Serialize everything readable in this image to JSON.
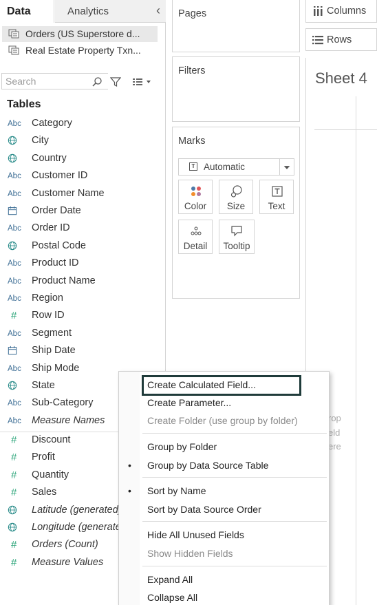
{
  "tabs": {
    "data": "Data",
    "analytics": "Analytics"
  },
  "datasources": [
    {
      "label": "Orders (US Superstore d...",
      "selected": true
    },
    {
      "label": "Real Estate Property Txn...",
      "selected": false
    }
  ],
  "search": {
    "placeholder": "Search"
  },
  "tables_heading": "Tables",
  "fields": [
    {
      "type": "abc",
      "label": "Category",
      "italic": false
    },
    {
      "type": "globe",
      "label": "City",
      "italic": false
    },
    {
      "type": "globe",
      "label": "Country",
      "italic": false
    },
    {
      "type": "abc",
      "label": "Customer ID",
      "italic": false
    },
    {
      "type": "abc",
      "label": "Customer Name",
      "italic": false
    },
    {
      "type": "calendar",
      "label": "Order Date",
      "italic": false
    },
    {
      "type": "abc",
      "label": "Order ID",
      "italic": false
    },
    {
      "type": "globe",
      "label": "Postal Code",
      "italic": false
    },
    {
      "type": "abc",
      "label": "Product ID",
      "italic": false
    },
    {
      "type": "abc",
      "label": "Product Name",
      "italic": false
    },
    {
      "type": "abc",
      "label": "Region",
      "italic": false
    },
    {
      "type": "hash",
      "label": "Row ID",
      "italic": false
    },
    {
      "type": "abc",
      "label": "Segment",
      "italic": false
    },
    {
      "type": "calendar",
      "label": "Ship Date",
      "italic": false
    },
    {
      "type": "abc",
      "label": "Ship Mode",
      "italic": false
    },
    {
      "type": "globe",
      "label": "State",
      "italic": false
    },
    {
      "type": "abc",
      "label": "Sub-Category",
      "italic": false
    },
    {
      "type": "abc",
      "label": "Measure Names",
      "italic": true
    }
  ],
  "measures": [
    {
      "type": "hash",
      "label": "Discount",
      "italic": false
    },
    {
      "type": "hash",
      "label": "Profit",
      "italic": false
    },
    {
      "type": "hash",
      "label": "Quantity",
      "italic": false
    },
    {
      "type": "hash",
      "label": "Sales",
      "italic": false
    },
    {
      "type": "globe",
      "label": "Latitude (generated)",
      "italic": true
    },
    {
      "type": "globe",
      "label": "Longitude (generated)",
      "italic": true
    },
    {
      "type": "hash",
      "label": "Orders (Count)",
      "italic": true
    },
    {
      "type": "hash",
      "label": "Measure Values",
      "italic": true
    }
  ],
  "shelves": {
    "pages": "Pages",
    "filters": "Filters",
    "marks": "Marks",
    "mark_type": "Automatic",
    "columns": "Columns",
    "rows": "Rows"
  },
  "mark_buttons": {
    "color": "Color",
    "size": "Size",
    "text": "Text",
    "detail": "Detail",
    "tooltip": "Tooltip"
  },
  "sheet": {
    "title": "Sheet 4",
    "drop_hint": [
      "rop",
      "eld",
      "ere"
    ]
  },
  "context_menu": {
    "items": [
      {
        "label": "Create Calculated Field...",
        "disabled": false,
        "bullet": false,
        "highlighted": true
      },
      {
        "label": "Create Parameter...",
        "disabled": false,
        "bullet": false
      },
      {
        "label": "Create Folder (use group by folder)",
        "disabled": true,
        "bullet": false
      },
      {
        "label": "Group by Folder",
        "disabled": false,
        "bullet": false
      },
      {
        "label": "Group by Data Source Table",
        "disabled": false,
        "bullet": true
      },
      {
        "label": "Sort by Name",
        "disabled": false,
        "bullet": true
      },
      {
        "label": "Sort by Data Source Order",
        "disabled": false,
        "bullet": false
      },
      {
        "label": "Hide All Unused Fields",
        "disabled": false,
        "bullet": false
      },
      {
        "label": "Show Hidden Fields",
        "disabled": true,
        "bullet": false
      },
      {
        "label": "Expand All",
        "disabled": false,
        "bullet": false
      },
      {
        "label": "Collapse All",
        "disabled": false,
        "bullet": false
      }
    ],
    "bullet_char": "•"
  },
  "colors": {
    "abc_icon": "#3f6f96",
    "measure_icon": "#2ea67b",
    "dim_globe": "#3f6f96",
    "highlight_border": "#1f3b3a"
  }
}
